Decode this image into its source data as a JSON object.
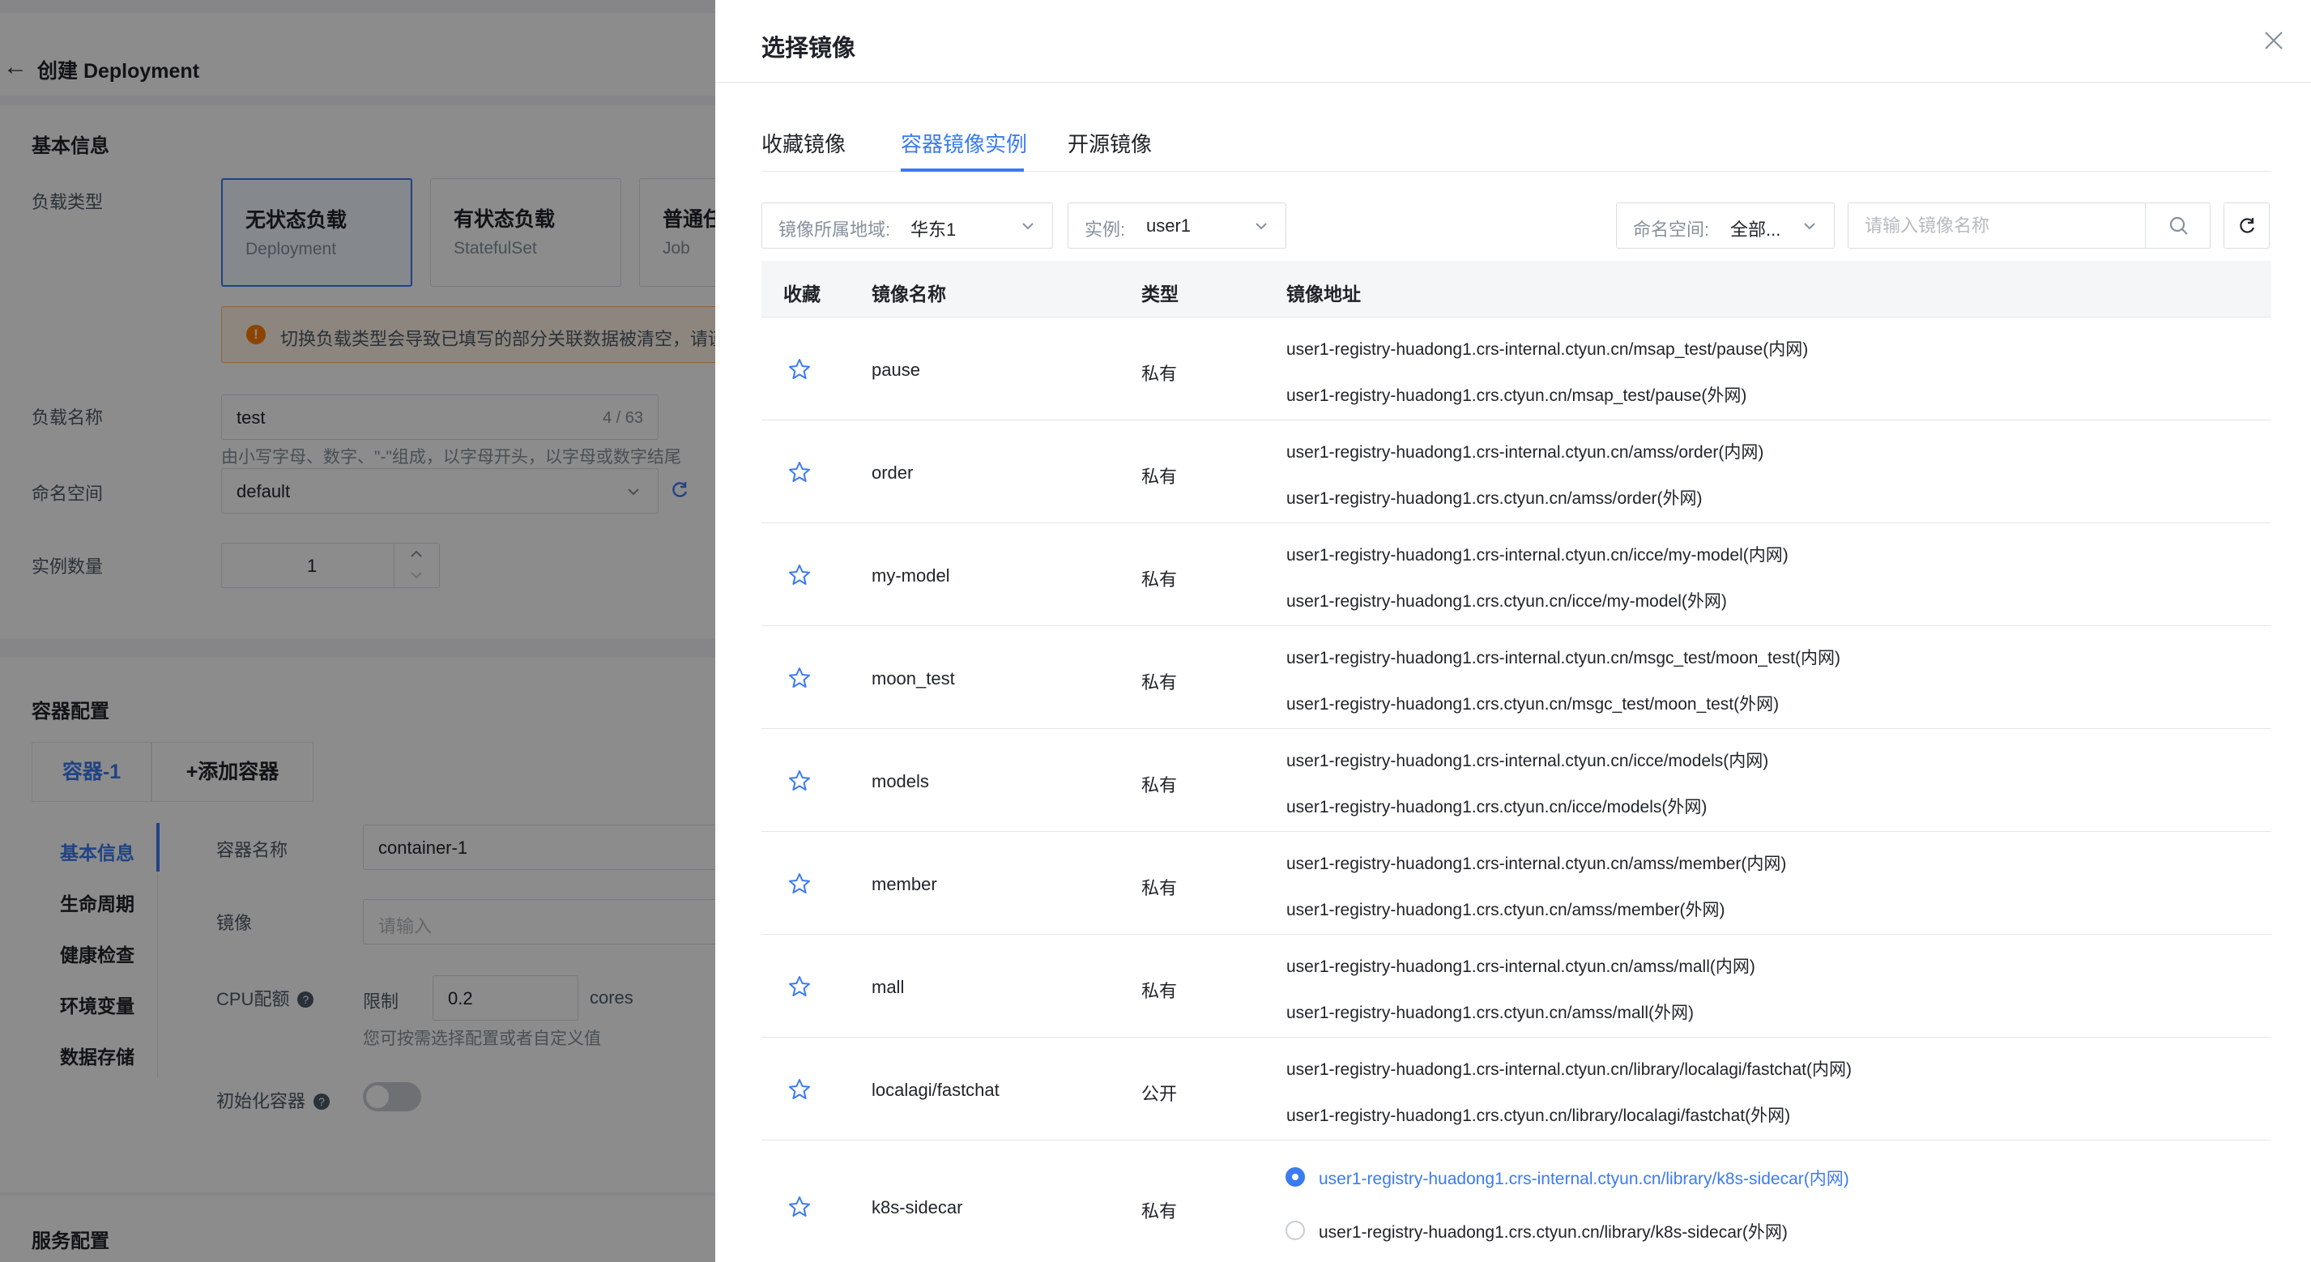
{
  "background_page": {
    "back_icon": "arrow-left-icon",
    "title": "创建 Deployment",
    "basic_info": {
      "section_title": "基本信息",
      "workload_type_label": "负载类型",
      "workload_types": [
        {
          "title": "无状态负载",
          "subtitle": "Deployment",
          "selected": true
        },
        {
          "title": "有状态负载",
          "subtitle": "StatefulSet",
          "selected": false
        },
        {
          "title": "普通任",
          "subtitle": "Job",
          "selected": false
        }
      ],
      "warning_text": "切换负载类型会导致已填写的部分关联数据被清空，请谨",
      "name_label": "负载名称",
      "name_value": "test",
      "name_count": "4 / 63",
      "name_hint": "由小写字母、数字、\"-\"组成，以字母开头，以字母或数字结尾",
      "namespace_label": "命名空间",
      "namespace_value": "default",
      "replicas_label": "实例数量",
      "replicas_value": "1"
    },
    "container_config": {
      "section_title": "容器配置",
      "tab_container": "容器-1",
      "tab_add": "+添加容器",
      "side_nav": [
        "基本信息",
        "生命周期",
        "健康检查",
        "环境变量",
        "数据存储"
      ],
      "container_name_label": "容器名称",
      "container_name_value": "container-1",
      "image_label": "镜像",
      "image_placeholder": "请输入",
      "cpu_label": "CPU配额",
      "cpu_limit_label": "限制",
      "cpu_value": "0.2",
      "cpu_unit": "cores",
      "cpu_hint": "您可按需选择配置或者自定义值",
      "init_container_label": "初始化容器"
    },
    "service_config": {
      "section_title": "服务配置"
    }
  },
  "drawer": {
    "title": "选择镜像",
    "close_icon": "close-icon",
    "tabs": [
      {
        "label": "收藏镜像",
        "active": false
      },
      {
        "label": "容器镜像实例",
        "active": true
      },
      {
        "label": "开源镜像",
        "active": false
      }
    ],
    "filters": {
      "region_label": "镜像所属地域:",
      "region_value": "华东1",
      "instance_label": "实例:",
      "instance_value": "user1",
      "namespace_label": "命名空间:",
      "namespace_value": "全部..."
    },
    "search": {
      "placeholder": "请输入镜像名称",
      "icon": "search-icon"
    },
    "refresh_icon": "refresh-icon",
    "table": {
      "headers": [
        "收藏",
        "镜像名称",
        "类型",
        "镜像地址"
      ],
      "rows": [
        {
          "name": "pause",
          "type": "私有",
          "addr_internal": "user1-registry-huadong1.crs-internal.ctyun.cn/msap_test/pause(内网)",
          "addr_external": "user1-registry-huadong1.crs.ctyun.cn/msap_test/pause(外网)"
        },
        {
          "name": "order",
          "type": "私有",
          "addr_internal": "user1-registry-huadong1.crs-internal.ctyun.cn/amss/order(内网)",
          "addr_external": "user1-registry-huadong1.crs.ctyun.cn/amss/order(外网)"
        },
        {
          "name": "my-model",
          "type": "私有",
          "addr_internal": "user1-registry-huadong1.crs-internal.ctyun.cn/icce/my-model(内网)",
          "addr_external": "user1-registry-huadong1.crs.ctyun.cn/icce/my-model(外网)"
        },
        {
          "name": "moon_test",
          "type": "私有",
          "addr_internal": "user1-registry-huadong1.crs-internal.ctyun.cn/msgc_test/moon_test(内网)",
          "addr_external": "user1-registry-huadong1.crs.ctyun.cn/msgc_test/moon_test(外网)"
        },
        {
          "name": "models",
          "type": "私有",
          "addr_internal": "user1-registry-huadong1.crs-internal.ctyun.cn/icce/models(内网)",
          "addr_external": "user1-registry-huadong1.crs.ctyun.cn/icce/models(外网)"
        },
        {
          "name": "member",
          "type": "私有",
          "addr_internal": "user1-registry-huadong1.crs-internal.ctyun.cn/amss/member(内网)",
          "addr_external": "user1-registry-huadong1.crs.ctyun.cn/amss/member(外网)"
        },
        {
          "name": "mall",
          "type": "私有",
          "addr_internal": "user1-registry-huadong1.crs-internal.ctyun.cn/amss/mall(内网)",
          "addr_external": "user1-registry-huadong1.crs.ctyun.cn/amss/mall(外网)"
        },
        {
          "name": "localagi/fastchat",
          "type": "公开",
          "addr_internal": "user1-registry-huadong1.crs-internal.ctyun.cn/library/localagi/fastchat(内网)",
          "addr_external": "user1-registry-huadong1.crs.ctyun.cn/library/localagi/fastchat(外网)"
        },
        {
          "name": "k8s-sidecar",
          "type": "私有",
          "addr_internal": "user1-registry-huadong1.crs-internal.ctyun.cn/library/k8s-sidecar(内网)",
          "addr_external": "user1-registry-huadong1.crs.ctyun.cn/library/k8s-sidecar(外网)",
          "selected_address": "internal"
        }
      ]
    }
  },
  "colors": {
    "accent": "#3b7bf0",
    "warning": "#ff7d00",
    "overlay": "rgba(0,0,0,0.45)"
  }
}
